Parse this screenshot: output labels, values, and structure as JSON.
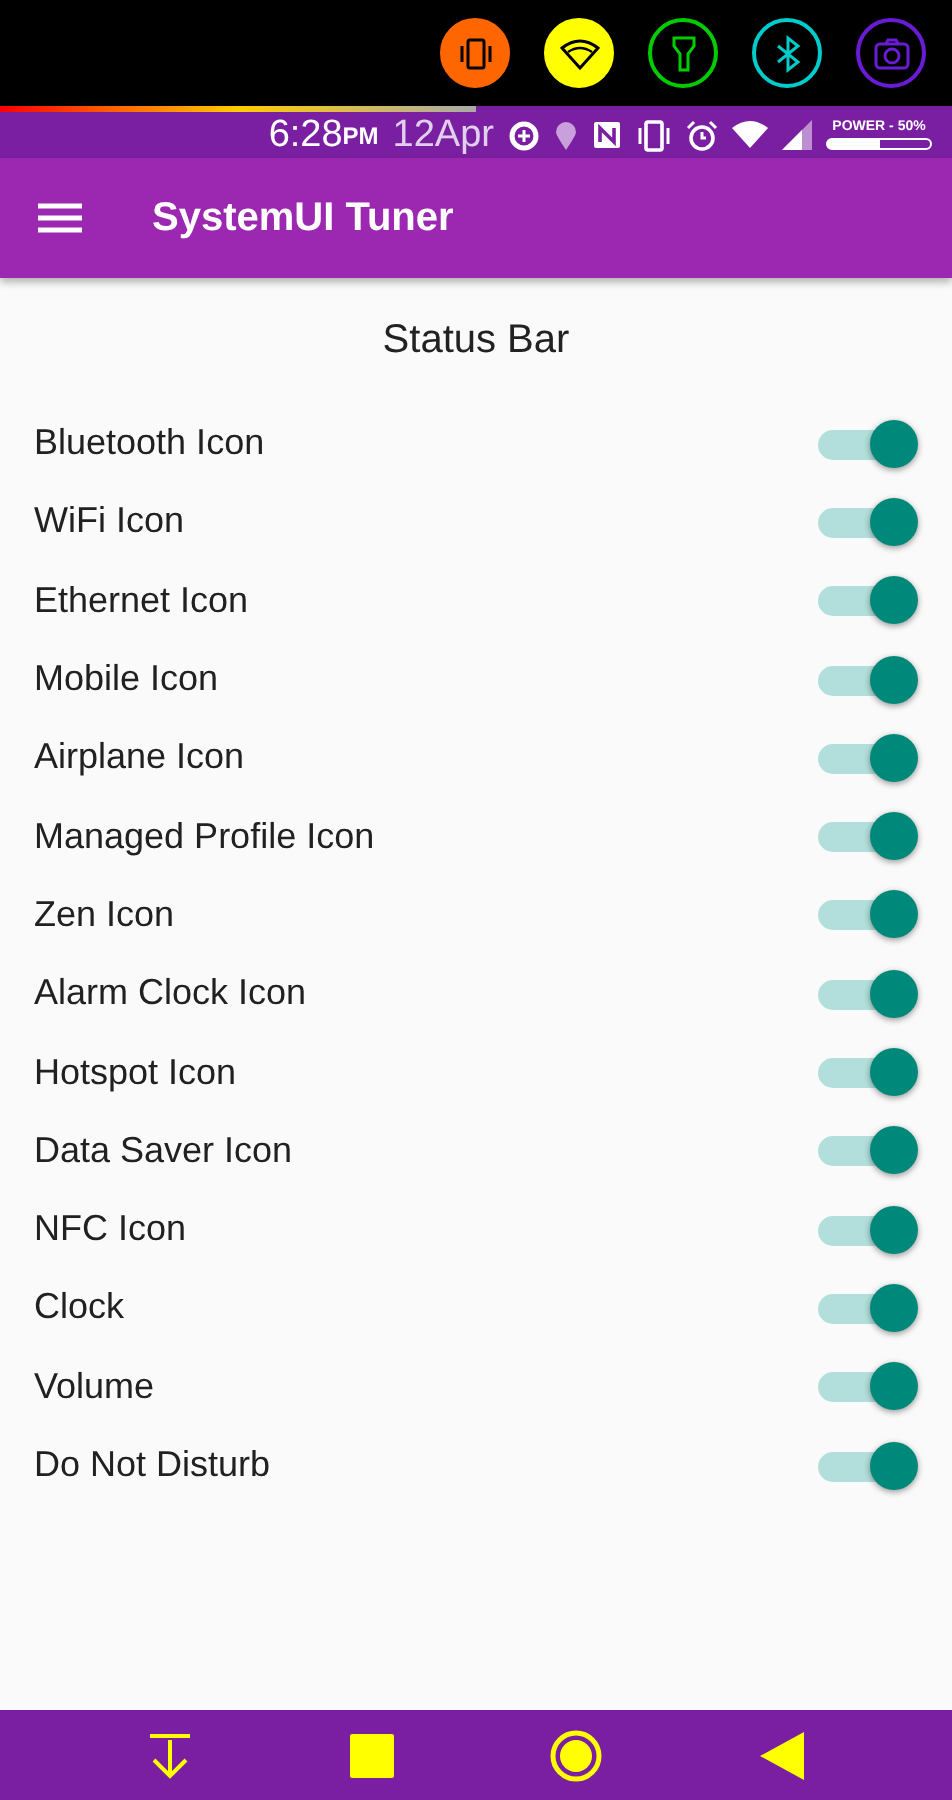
{
  "quick_toggles": [
    {
      "kind": "vibrate",
      "color": "#ff6600",
      "on": true
    },
    {
      "kind": "wifi",
      "color": "#ffff00",
      "on": true
    },
    {
      "kind": "flashlight",
      "color": "#00cc00",
      "on": false
    },
    {
      "kind": "bluetooth",
      "color": "#00cccc",
      "on": false
    },
    {
      "kind": "camera",
      "color": "#6a1bd6",
      "on": false
    }
  ],
  "progress_line": {
    "level": 0.5
  },
  "status_bar": {
    "time": "6:28",
    "ampm": "PM",
    "date": "12Apr",
    "battery_label": "POWER - 50%",
    "battery": {
      "level": 0.5
    }
  },
  "app_bar": {
    "title": "SystemUI Tuner"
  },
  "section_title": "Status Bar",
  "settings": [
    {
      "label": "Bluetooth Icon",
      "on": true
    },
    {
      "label": "WiFi Icon",
      "on": true
    },
    {
      "label": "Ethernet Icon",
      "on": true
    },
    {
      "label": "Mobile Icon",
      "on": true
    },
    {
      "label": "Airplane Icon",
      "on": true
    },
    {
      "label": "Managed Profile Icon",
      "on": true
    },
    {
      "label": "Zen Icon",
      "on": true
    },
    {
      "label": "Alarm Clock Icon",
      "on": true
    },
    {
      "label": "Hotspot Icon",
      "on": true
    },
    {
      "label": "Data Saver Icon",
      "on": true
    },
    {
      "label": "NFC Icon",
      "on": true
    },
    {
      "label": "Clock",
      "on": true
    },
    {
      "label": "Volume",
      "on": true
    },
    {
      "label": "Do Not Disturb",
      "on": true
    }
  ]
}
